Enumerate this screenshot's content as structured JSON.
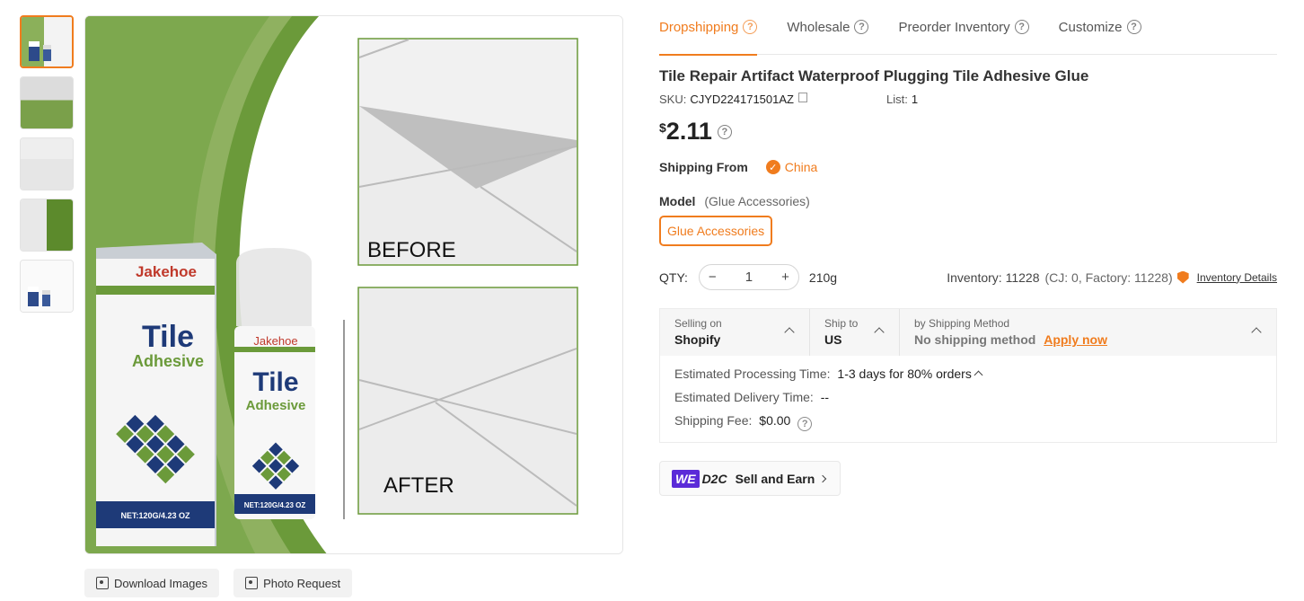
{
  "tabs": [
    {
      "label": "Dropshipping",
      "active": true
    },
    {
      "label": "Wholesale",
      "active": false
    },
    {
      "label": "Preorder Inventory",
      "active": false
    },
    {
      "label": "Customize",
      "active": false
    }
  ],
  "product": {
    "title": "Tile Repair Artifact Waterproof Plugging Tile Adhesive Glue",
    "sku_label": "SKU:",
    "sku": "CJYD224171501AZ",
    "list_label": "List:",
    "list_value": "1",
    "currency": "$",
    "price": "2.11"
  },
  "shipping_from": {
    "label": "Shipping From",
    "country": "China"
  },
  "model": {
    "label": "Model",
    "selected_hint": "(Glue Accessories)",
    "option": "Glue Accessories"
  },
  "qty": {
    "label": "QTY:",
    "value": "1",
    "minus": "−",
    "plus": "+",
    "weight": "210g"
  },
  "inventory": {
    "label": "Inventory: 11228",
    "detail": "(CJ: 0, Factory: 11228)",
    "link": "Inventory Details"
  },
  "shipping_box": {
    "selling_on_label": "Selling on",
    "selling_on_value": "Shopify",
    "ship_to_label": "Ship to",
    "ship_to_value": "US",
    "method_label": "by Shipping Method",
    "method_value": "No shipping method",
    "apply": "Apply now",
    "processing_label": "Estimated Processing Time:",
    "processing_value": "1-3 days for 80% orders",
    "delivery_label": "Estimated Delivery Time:",
    "delivery_value": "--",
    "fee_label": "Shipping Fee:",
    "fee_value": "$0.00"
  },
  "d2c": {
    "badge": "WE",
    "brand": "D2C",
    "cta": "Sell and Earn"
  },
  "image_actions": {
    "download": "Download Images",
    "photo_request": "Photo Request"
  },
  "image_text": {
    "brand": "Jakehoe",
    "product_word1": "Tile",
    "product_word2": "Adhesive",
    "net": "NET:120G/4.23 OZ",
    "before": "BEFORE",
    "after": "AFTER"
  },
  "colors": {
    "accent": "#f07c1e",
    "green": "#6b9a3a",
    "navy": "#1e3a78",
    "we_purple": "#5b2bd8"
  }
}
